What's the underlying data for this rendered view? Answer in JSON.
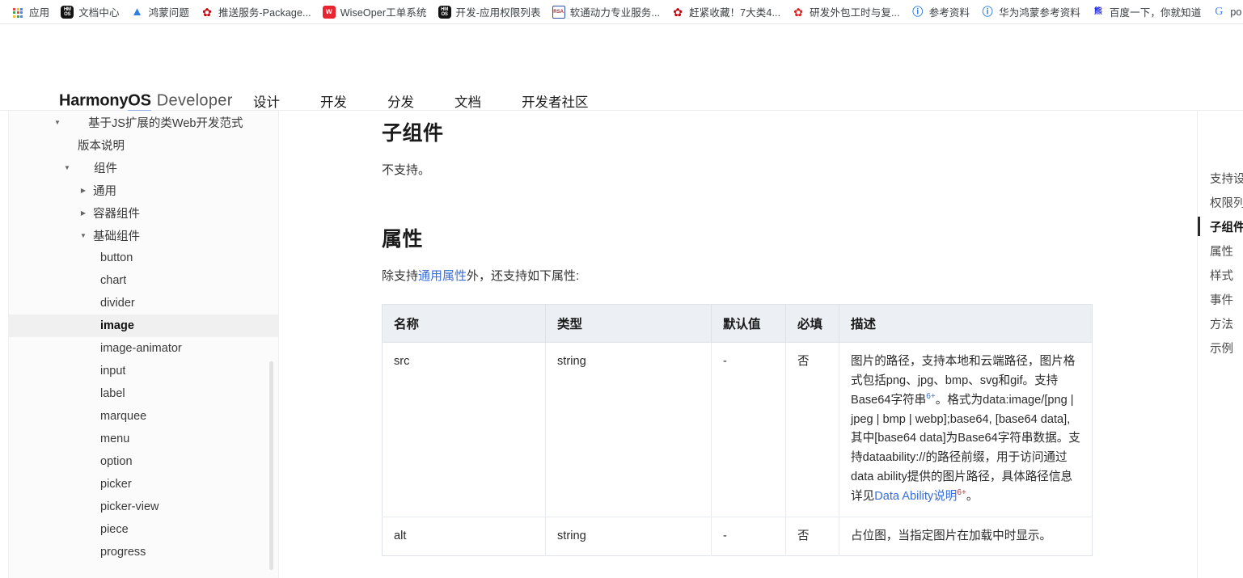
{
  "browser": {
    "bookmarks": [
      {
        "label": "应用",
        "icon": "apps-grid-icon"
      },
      {
        "label": "文档中心",
        "icon": "hmos-icon"
      },
      {
        "label": "鸿蒙问题",
        "icon": "blue-triangle-icon"
      },
      {
        "label": "推送服务-Package...",
        "icon": "huawei-flower-icon"
      },
      {
        "label": "WiseOper工单系统",
        "icon": "red-square-w-icon"
      },
      {
        "label": "开发-应用权限列表",
        "icon": "hmos-icon"
      },
      {
        "label": "软通动力专业服务...",
        "icon": "rsa-icon"
      },
      {
        "label": "赶紧收藏！7大类4...",
        "icon": "huawei-flower-icon"
      },
      {
        "label": "研发外包工时与复...",
        "icon": "red-leaf-icon"
      },
      {
        "label": "参考资料",
        "icon": "reference-icon"
      },
      {
        "label": "华为鸿蒙参考资料",
        "icon": "reference-icon"
      },
      {
        "label": "百度一下，你就知道",
        "icon": "baidu-icon"
      },
      {
        "label": "po",
        "icon": "google-g-icon"
      }
    ]
  },
  "header": {
    "logo_brand_pre": "Harmony",
    "logo_brand_os": "OS",
    "logo_developer": "Developer",
    "nav": [
      {
        "label": "设计"
      },
      {
        "label": "开发"
      },
      {
        "label": "分发"
      },
      {
        "label": "文档"
      },
      {
        "label": "开发者社区"
      }
    ]
  },
  "sidebar": {
    "items": [
      {
        "label": "基于JS扩展的类Web开发范式",
        "level": 0,
        "twisty": "expanded",
        "active": false
      },
      {
        "label": "版本说明",
        "level": 1,
        "twisty": "none",
        "active": false
      },
      {
        "label": "组件",
        "level": 2,
        "twisty": "expanded",
        "active": false
      },
      {
        "label": "通用",
        "level": 3,
        "twisty": "collapsed",
        "active": false
      },
      {
        "label": "容器组件",
        "level": 3,
        "twisty": "collapsed",
        "active": false
      },
      {
        "label": "基础组件",
        "level": 3,
        "twisty": "expanded",
        "active": false
      },
      {
        "label": "button",
        "level": 4,
        "twisty": "none",
        "active": false
      },
      {
        "label": "chart",
        "level": 4,
        "twisty": "none",
        "active": false
      },
      {
        "label": "divider",
        "level": 4,
        "twisty": "none",
        "active": false
      },
      {
        "label": "image",
        "level": 4,
        "twisty": "none",
        "active": true
      },
      {
        "label": "image-animator",
        "level": 4,
        "twisty": "none",
        "active": false
      },
      {
        "label": "input",
        "level": 4,
        "twisty": "none",
        "active": false
      },
      {
        "label": "label",
        "level": 4,
        "twisty": "none",
        "active": false
      },
      {
        "label": "marquee",
        "level": 4,
        "twisty": "none",
        "active": false
      },
      {
        "label": "menu",
        "level": 4,
        "twisty": "none",
        "active": false
      },
      {
        "label": "option",
        "level": 4,
        "twisty": "none",
        "active": false
      },
      {
        "label": "picker",
        "level": 4,
        "twisty": "none",
        "active": false
      },
      {
        "label": "picker-view",
        "level": 4,
        "twisty": "none",
        "active": false
      },
      {
        "label": "piece",
        "level": 4,
        "twisty": "none",
        "active": false
      },
      {
        "label": "progress",
        "level": 4,
        "twisty": "none",
        "active": false
      }
    ]
  },
  "doc": {
    "section_child_components_title": "子组件",
    "section_child_components_body": "不支持。",
    "section_attributes_title": "属性",
    "attributes_intro_pre": "除支持",
    "attributes_intro_link": "通用属性",
    "attributes_intro_post": "外，还支持如下属性:",
    "table": {
      "headers": [
        "名称",
        "类型",
        "默认值",
        "必填",
        "描述"
      ],
      "rows": [
        {
          "name": "src",
          "type": "string",
          "default": "-",
          "required": "否",
          "desc_part1": "图片的路径，支持本地和云端路径，图片格式包括png、jpg、bmp、svg和gif。支持Base64字符串",
          "desc_sup1": "6+",
          "desc_part2": "。格式为data:image/[png | jpeg | bmp | webp];base64, [base64 data], 其中[base64 data]为Base64字符串数据。支持dataability://的路径前缀，用于访问通过data ability提供的图片路径，具体路径信息详见",
          "desc_link": "Data Ability说明",
          "desc_sup2": "6+",
          "desc_part3": "。"
        },
        {
          "name": "alt",
          "type": "string",
          "default": "-",
          "required": "否",
          "desc_part1": "占位图，当指定图片在加载中时显示。",
          "desc_sup1": "",
          "desc_part2": "",
          "desc_link": "",
          "desc_sup2": "",
          "desc_part3": ""
        }
      ]
    }
  },
  "right_toc": {
    "items": [
      {
        "label": "支持设",
        "active": false
      },
      {
        "label": "权限列",
        "active": false
      },
      {
        "label": "子组件",
        "active": true
      },
      {
        "label": "属性",
        "active": false
      },
      {
        "label": "样式",
        "active": false
      },
      {
        "label": "事件",
        "active": false
      },
      {
        "label": "方法",
        "active": false
      },
      {
        "label": "示例",
        "active": false
      }
    ]
  },
  "colors": {
    "link_blue": "#376ed8",
    "brand_underline": "#3b6fe0",
    "table_header_bg": "#eceff3",
    "active_sidebar_bg": "#f0f0f0"
  }
}
